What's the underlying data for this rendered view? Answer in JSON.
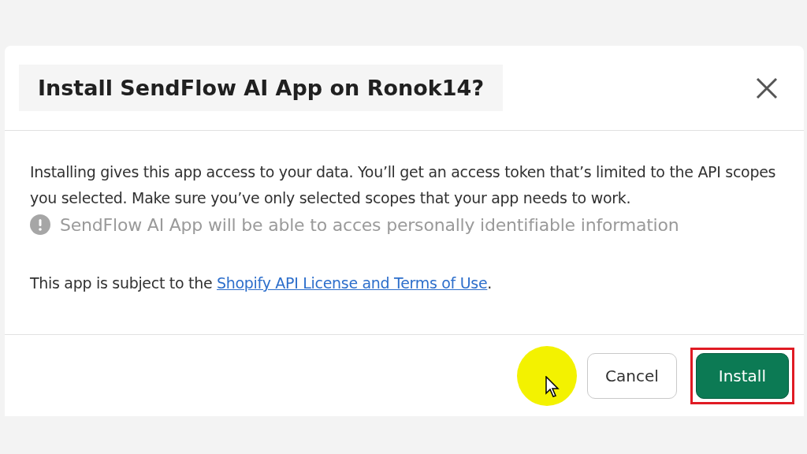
{
  "dialog": {
    "title": "Install SendFlow AI App on Ronok14?",
    "description": "Installing gives this app access to your data. You’ll get an access token that’s limited to the API scopes you selected. Make sure you’ve only selected scopes that your app needs to work.",
    "warning": "SendFlow AI App will be able to acces personally identifiable information",
    "terms_prefix": "This app is subject to the ",
    "terms_link": "Shopify API License and Terms of Use",
    "terms_suffix": ".",
    "buttons": [
      {
        "label": "Cancel",
        "kind": "secondary",
        "highlighted": false
      },
      {
        "label": "Install",
        "kind": "primary",
        "highlighted": true
      }
    ]
  }
}
